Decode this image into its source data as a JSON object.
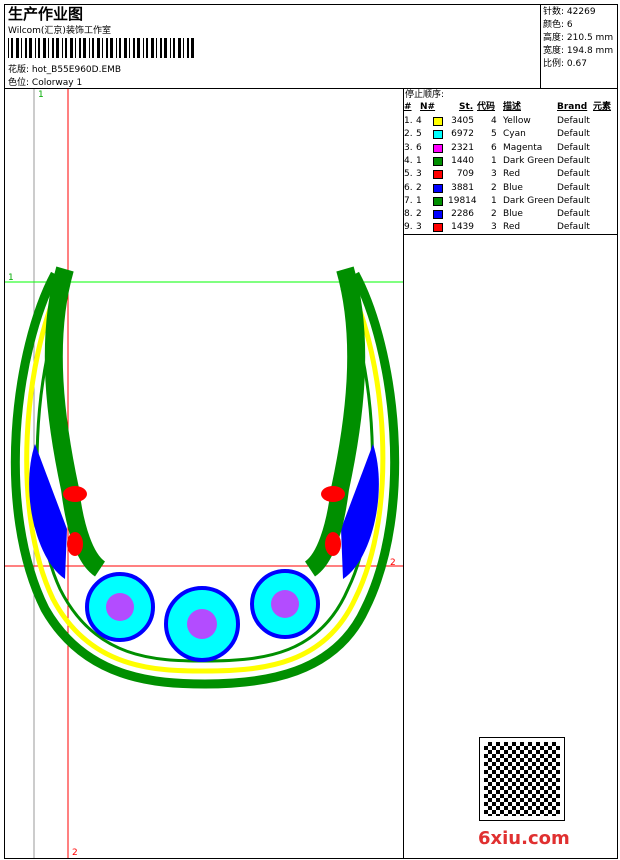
{
  "header": {
    "title": "生产作业图",
    "company": "Wilcom(汇京)装饰工作室",
    "design_label": "花版:",
    "design_file": "hot_B55E960D.EMB",
    "colorway_label": "色位:",
    "colorway": "Colorway 1"
  },
  "stats": [
    {
      "label": "针数:",
      "value": "42269"
    },
    {
      "label": "颜色:",
      "value": "6"
    },
    {
      "label": "高度:",
      "value": "210.5 mm"
    },
    {
      "label": "宽度:",
      "value": "194.8 mm"
    },
    {
      "label": "比例:",
      "value": "0.67"
    }
  ],
  "stop_sequence": {
    "title": "停止顺序:",
    "columns": [
      "#",
      "N#",
      "St.",
      "代码",
      "描述",
      "Brand",
      "元素"
    ],
    "rows": [
      {
        "idx": "1.",
        "n": "4",
        "color": "#ffff00",
        "st": "3405",
        "code": "4",
        "desc": "Yellow",
        "brand": "Default"
      },
      {
        "idx": "2.",
        "n": "5",
        "color": "#00ffff",
        "st": "6972",
        "code": "5",
        "desc": "Cyan",
        "brand": "Default"
      },
      {
        "idx": "3.",
        "n": "6",
        "color": "#ff00ff",
        "st": "2321",
        "code": "6",
        "desc": "Magenta",
        "brand": "Default"
      },
      {
        "idx": "4.",
        "n": "1",
        "color": "#008f00",
        "st": "1440",
        "code": "1",
        "desc": "Dark Green",
        "brand": "Default"
      },
      {
        "idx": "5.",
        "n": "3",
        "color": "#ff0000",
        "st": "709",
        "code": "3",
        "desc": "Red",
        "brand": "Default"
      },
      {
        "idx": "6.",
        "n": "2",
        "color": "#0000ff",
        "st": "3881",
        "code": "2",
        "desc": "Blue",
        "brand": "Default"
      },
      {
        "idx": "7.",
        "n": "1",
        "color": "#008f00",
        "st": "19814",
        "code": "1",
        "desc": "Dark Green",
        "brand": "Default"
      },
      {
        "idx": "8.",
        "n": "2",
        "color": "#0000ff",
        "st": "2286",
        "code": "2",
        "desc": "Blue",
        "brand": "Default"
      },
      {
        "idx": "9.",
        "n": "3",
        "color": "#ff0000",
        "st": "1439",
        "code": "3",
        "desc": "Red",
        "brand": "Default"
      }
    ]
  },
  "guides": {
    "top": "1",
    "left": "1",
    "right": "2",
    "bottom": "2"
  },
  "watermark": "6xiu.com"
}
